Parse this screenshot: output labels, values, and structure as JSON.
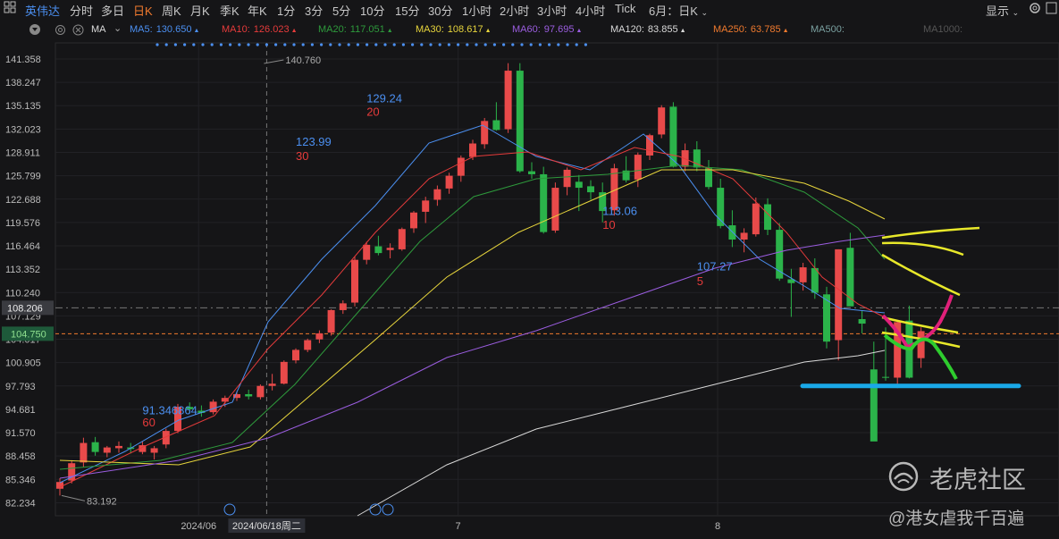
{
  "toolbar": {
    "symbol_name": "英伟达",
    "periods": [
      "分时",
      "多日",
      "日K",
      "周K",
      "月K",
      "季K",
      "年K",
      "1分",
      "3分",
      "5分",
      "10分",
      "15分",
      "30分",
      "1小时",
      "2小时",
      "3小时",
      "4小时",
      "Tick"
    ],
    "active_period": "日K",
    "range_select": "6月：日K",
    "display_label": "显示"
  },
  "indicator": {
    "name": "MA",
    "items": [
      {
        "label": "MA5:",
        "value": "130.650",
        "color": "#4b8ff0",
        "arrow": "▲"
      },
      {
        "label": "MA10:",
        "value": "126.023",
        "color": "#e63b3b",
        "arrow": "▲"
      },
      {
        "label": "MA20:",
        "value": "117.051",
        "color": "#2e9a3c",
        "arrow": "▲"
      },
      {
        "label": "MA30:",
        "value": "108.617",
        "color": "#e7d53c",
        "arrow": "▲"
      },
      {
        "label": "MA60:",
        "value": "97.695",
        "color": "#9b5de0",
        "arrow": "▲"
      },
      {
        "label": "MA120:",
        "value": "83.855",
        "color": "#d9d9d9",
        "arrow": "▲"
      },
      {
        "label": "MA250:",
        "value": "63.785",
        "color": "#f07a2e",
        "arrow": "▲"
      },
      {
        "label": "MA500:",
        "value": "",
        "color": "#7aa0a0",
        "arrow": ""
      },
      {
        "label": "MA1000:",
        "value": "",
        "color": "#555555",
        "arrow": ""
      }
    ]
  },
  "chart_data": {
    "type": "candlestick",
    "y_ticks": [
      "141.358",
      "138.247",
      "135.135",
      "132.023",
      "128.911",
      "125.799",
      "122.688",
      "119.576",
      "116.464",
      "113.352",
      "110.240",
      "107.129",
      "104.017",
      "100.905",
      "97.793",
      "94.681",
      "91.570",
      "88.458",
      "85.346",
      "82.234"
    ],
    "ylim": [
      80.5,
      143.5
    ],
    "x_labels": [
      {
        "text": "2024/06",
        "index": 11
      },
      {
        "text": "7",
        "index": 33
      },
      {
        "text": "8",
        "index": 55
      }
    ],
    "crosshair": {
      "date_label": "2024/06/18周二",
      "index": 17,
      "price_label": "108.206",
      "price": 108.206
    },
    "last_price": {
      "label": "104.750",
      "price": 104.75,
      "color": "#f07a2e"
    },
    "annotations": [
      {
        "text": "140.760",
        "index": 17,
        "price": 140.76,
        "type": "high"
      },
      {
        "text": "83.192",
        "index": 0,
        "price": 83.192,
        "type": "low"
      },
      {
        "text": "91.346864",
        "index": 7,
        "price": 94.0,
        "color": "#4b8ff0"
      },
      {
        "text": "60",
        "index": 7,
        "price": 92.4,
        "color": "#e63b3b"
      },
      {
        "text": "123.99",
        "index": 20,
        "price": 129.8,
        "color": "#4b8ff0"
      },
      {
        "text": "30",
        "index": 20,
        "price": 127.9,
        "color": "#e63b3b"
      },
      {
        "text": "129.24",
        "index": 26,
        "price": 135.6,
        "color": "#4b8ff0"
      },
      {
        "text": "20",
        "index": 26,
        "price": 133.8,
        "color": "#e63b3b"
      },
      {
        "text": "113.06",
        "index": 46,
        "price": 120.6,
        "color": "#4b8ff0"
      },
      {
        "text": "10",
        "index": 46,
        "price": 118.7,
        "color": "#e63b3b"
      },
      {
        "text": "107.27",
        "index": 54,
        "price": 113.2,
        "color": "#4b8ff0"
      },
      {
        "text": "5",
        "index": 54,
        "price": 111.2,
        "color": "#e63b3b"
      }
    ],
    "candles": [
      [
        84.1,
        85.5,
        83.2,
        85.0
      ],
      [
        85.2,
        87.9,
        84.8,
        87.5
      ],
      [
        87.6,
        90.9,
        87.0,
        90.2
      ],
      [
        90.3,
        91.0,
        88.5,
        89.0
      ],
      [
        88.9,
        89.8,
        88.3,
        89.6
      ],
      [
        89.5,
        90.4,
        88.9,
        89.8
      ],
      [
        89.6,
        90.2,
        88.8,
        89.4
      ],
      [
        89.0,
        90.4,
        88.7,
        89.9
      ],
      [
        88.9,
        89.8,
        88.0,
        89.5
      ],
      [
        90.0,
        92.1,
        89.5,
        91.8
      ],
      [
        91.8,
        95.4,
        91.5,
        95.0
      ],
      [
        95.0,
        95.6,
        94.2,
        94.7
      ],
      [
        94.5,
        95.2,
        93.7,
        94.2
      ],
      [
        94.3,
        96.0,
        94.0,
        95.7
      ],
      [
        95.7,
        96.5,
        95.0,
        96.2
      ],
      [
        96.2,
        97.1,
        95.8,
        96.7
      ],
      [
        96.7,
        97.3,
        96.0,
        96.4
      ],
      [
        96.3,
        98.0,
        96.0,
        97.8
      ],
      [
        97.8,
        99.4,
        97.2,
        98.1
      ],
      [
        98.1,
        101.2,
        98.0,
        101.0
      ],
      [
        101.2,
        102.8,
        100.8,
        102.6
      ],
      [
        102.6,
        104.1,
        102.3,
        103.9
      ],
      [
        104.0,
        105.2,
        103.5,
        104.8
      ],
      [
        104.9,
        108.0,
        104.5,
        107.9
      ],
      [
        107.9,
        109.2,
        107.4,
        108.8
      ],
      [
        108.9,
        115.1,
        108.4,
        114.6
      ],
      [
        114.6,
        117.0,
        114.0,
        116.6
      ],
      [
        116.4,
        117.8,
        115.2,
        115.5
      ],
      [
        115.9,
        116.8,
        114.8,
        116.2
      ],
      [
        116.0,
        118.9,
        115.8,
        118.7
      ],
      [
        118.8,
        121.1,
        118.2,
        120.9
      ]
    ],
    "note_ma": "moving averages MA5 MA10 MA20 MA30 MA60 MA120",
    "drawings": [
      {
        "type": "horizontal",
        "price": 97.8,
        "color": "#1aa8e8"
      },
      {
        "type": "curve",
        "color": "#e8e82a"
      },
      {
        "type": "curve",
        "color": "#e0207a"
      },
      {
        "type": "curve",
        "color": "#2ecc2e"
      }
    ]
  },
  "watermark": {
    "brand": "老虎社区",
    "author": "@港女虐我千百遍"
  }
}
